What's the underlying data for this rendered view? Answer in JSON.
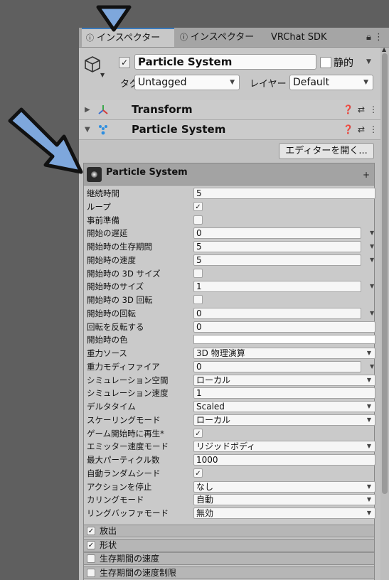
{
  "tabs": [
    {
      "label": "インスペクター",
      "icon": "info-icon",
      "active": true
    },
    {
      "label": "インスペクター",
      "icon": "info-icon",
      "active": false
    },
    {
      "label": "VRChat SDK",
      "active": false
    }
  ],
  "header": {
    "object_name": "Particle System",
    "static_label": "静的",
    "tag_label": "タグ",
    "tag_value": "Untagged",
    "layer_label": "レイヤー",
    "layer_value": "Default"
  },
  "components": [
    {
      "name": "Transform",
      "icon": "transform-axes-icon"
    },
    {
      "name": "Particle System",
      "icon": "particle-icon"
    }
  ],
  "editor_button": "エディターを開く...",
  "particle_panel": {
    "title": "Particle System",
    "properties": [
      {
        "label": "継続時間",
        "value": "5",
        "kind": "full"
      },
      {
        "label": "ループ",
        "checked": "✓",
        "kind": "check"
      },
      {
        "label": "事前準備",
        "checked": "",
        "kind": "check"
      },
      {
        "label": "開始の遅延",
        "value": "0",
        "kind": "arrow"
      },
      {
        "label": "開始時の生存期間",
        "value": "5",
        "kind": "arrow"
      },
      {
        "label": "開始時の速度",
        "value": "5",
        "kind": "arrow"
      },
      {
        "label": "開始時の 3D サイズ",
        "checked": "",
        "kind": "check"
      },
      {
        "label": "開始時のサイズ",
        "value": "1",
        "kind": "arrow"
      },
      {
        "label": "開始時の 3D 回転",
        "checked": "",
        "kind": "check"
      },
      {
        "label": "開始時の回転",
        "value": "0",
        "kind": "arrow"
      },
      {
        "label": "回転を反転する",
        "value": "0",
        "kind": "full"
      },
      {
        "label": "開始時の色",
        "kind": "color"
      },
      {
        "label": "重力ソース",
        "value": "3D 物理演算",
        "kind": "dropdown"
      },
      {
        "label": "重力モディファイア",
        "value": "0",
        "kind": "arrow"
      },
      {
        "label": "シミュレーション空間",
        "value": "ローカル",
        "kind": "dropdown"
      },
      {
        "label": "シミュレーション速度",
        "value": "1",
        "kind": "full"
      },
      {
        "label": "デルタタイム",
        "value": "Scaled",
        "kind": "dropdown"
      },
      {
        "label": "スケーリングモード",
        "value": "ローカル",
        "kind": "dropdown"
      },
      {
        "label": "ゲーム開始時に再生*",
        "checked": "✓",
        "kind": "check"
      },
      {
        "label": "エミッター速度モード",
        "value": "リジッドボディ",
        "kind": "dropdown"
      },
      {
        "label": "最大パーティクル数",
        "value": "1000",
        "kind": "full"
      },
      {
        "label": "自動ランダムシード",
        "checked": "✓",
        "kind": "check"
      },
      {
        "label": "アクションを停止",
        "value": "なし",
        "kind": "dropdown"
      },
      {
        "label": "カリングモード",
        "value": "自動",
        "kind": "dropdown"
      },
      {
        "label": "リングバッファモード",
        "value": "無効",
        "kind": "dropdown"
      }
    ]
  },
  "modules": [
    {
      "label": "放出",
      "checked": "✓"
    },
    {
      "label": "形状",
      "checked": "✓"
    },
    {
      "label": "生存期間の速度",
      "checked": ""
    },
    {
      "label": "生存期間の速度制限",
      "checked": ""
    }
  ],
  "colors": {
    "annotation_arrow": "#7ea7dc",
    "annotation_outline": "#111111",
    "active_tab_accent": "#3a79bb"
  }
}
